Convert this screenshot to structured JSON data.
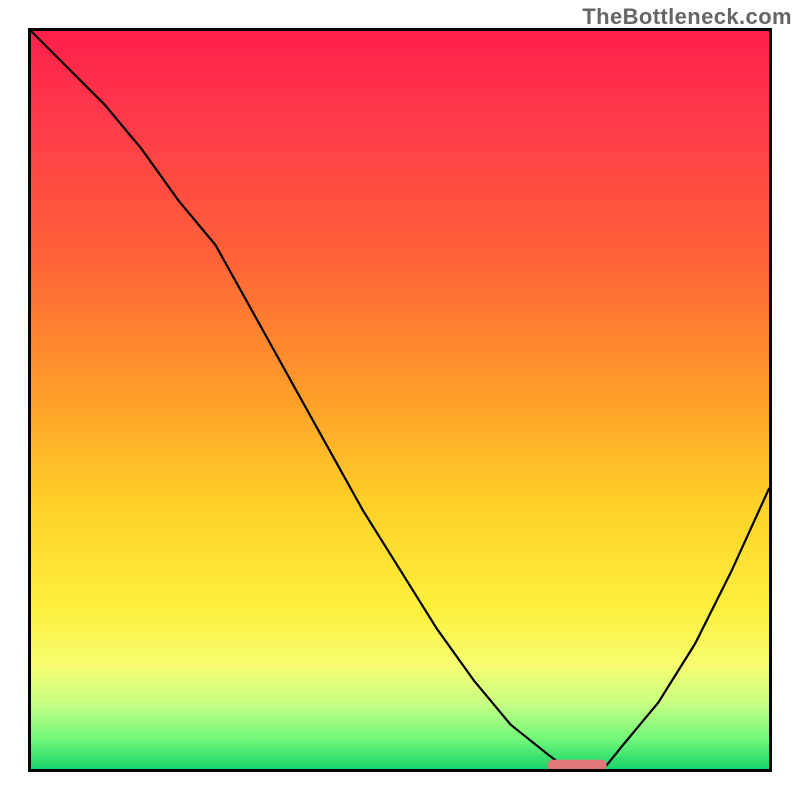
{
  "branding": {
    "watermark": "TheBottleneck.com"
  },
  "colors": {
    "gradient_top": "#ff1f4a",
    "gradient_bottom": "#17d46a",
    "curve": "#000000",
    "axes": "#000000",
    "marker": "#e07878"
  },
  "chart_data": {
    "type": "line",
    "title": "",
    "xlabel": "",
    "ylabel": "",
    "xlim": [
      0,
      100
    ],
    "ylim": [
      0,
      100
    ],
    "grid": false,
    "legend": false,
    "description": "Single black curve over a red-to-green vertical heat gradient; curve starts at top-left, descends steeply, bottoms out near x≈72–78, then rises toward the right edge. A short salmon marker sits at the trough on the baseline.",
    "series": [
      {
        "name": "bottleneck-curve",
        "x": [
          0,
          5,
          10,
          15,
          20,
          25,
          30,
          35,
          40,
          45,
          50,
          55,
          60,
          65,
          70,
          72,
          75,
          78,
          80,
          85,
          90,
          95,
          100
        ],
        "y": [
          100,
          95,
          90,
          84,
          77,
          71,
          62,
          53,
          44,
          35,
          27,
          19,
          12,
          6,
          2,
          0.5,
          0.5,
          0.5,
          3,
          9,
          17,
          27,
          38
        ]
      }
    ],
    "marker": {
      "x_start": 70,
      "x_end": 78,
      "y": 0.5,
      "shape": "rounded-bar"
    }
  }
}
